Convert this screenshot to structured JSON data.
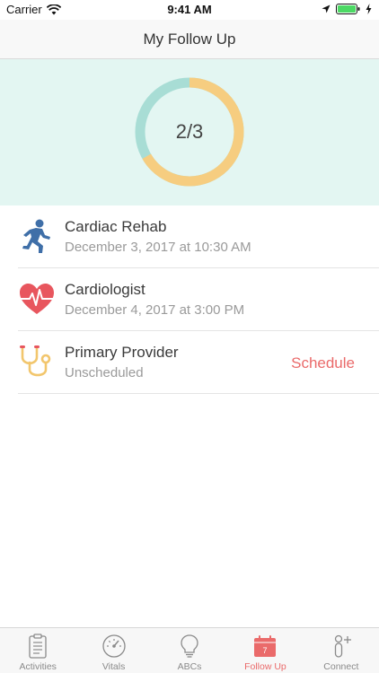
{
  "status_bar": {
    "carrier": "Carrier",
    "time": "9:41 AM"
  },
  "nav": {
    "title": "My Follow Up"
  },
  "progress": {
    "label": "2/3",
    "completed": 2,
    "total": 3,
    "completed_color": "#f6cd80",
    "remaining_color": "#a8ddd5"
  },
  "items": [
    {
      "title": "Cardiac Rehab",
      "subtitle": "December 3, 2017 at 10:30 AM",
      "icon": "running-person-icon"
    },
    {
      "title": "Cardiologist",
      "subtitle": "December 4, 2017 at 3:00 PM",
      "icon": "heart-pulse-icon"
    },
    {
      "title": "Primary Provider",
      "subtitle": "Unscheduled",
      "icon": "stethoscope-icon",
      "action": "Schedule"
    }
  ],
  "tabs": [
    {
      "label": "Activities",
      "icon": "clipboard-icon"
    },
    {
      "label": "Vitals",
      "icon": "gauge-icon"
    },
    {
      "label": "ABCs",
      "icon": "lightbulb-icon"
    },
    {
      "label": "Follow Up",
      "icon": "calendar-icon",
      "badge": "7",
      "active": true
    },
    {
      "label": "Connect",
      "icon": "person-add-icon"
    }
  ],
  "colors": {
    "accent": "#ea6a6a",
    "panel_bg": "#e3f6f2"
  }
}
